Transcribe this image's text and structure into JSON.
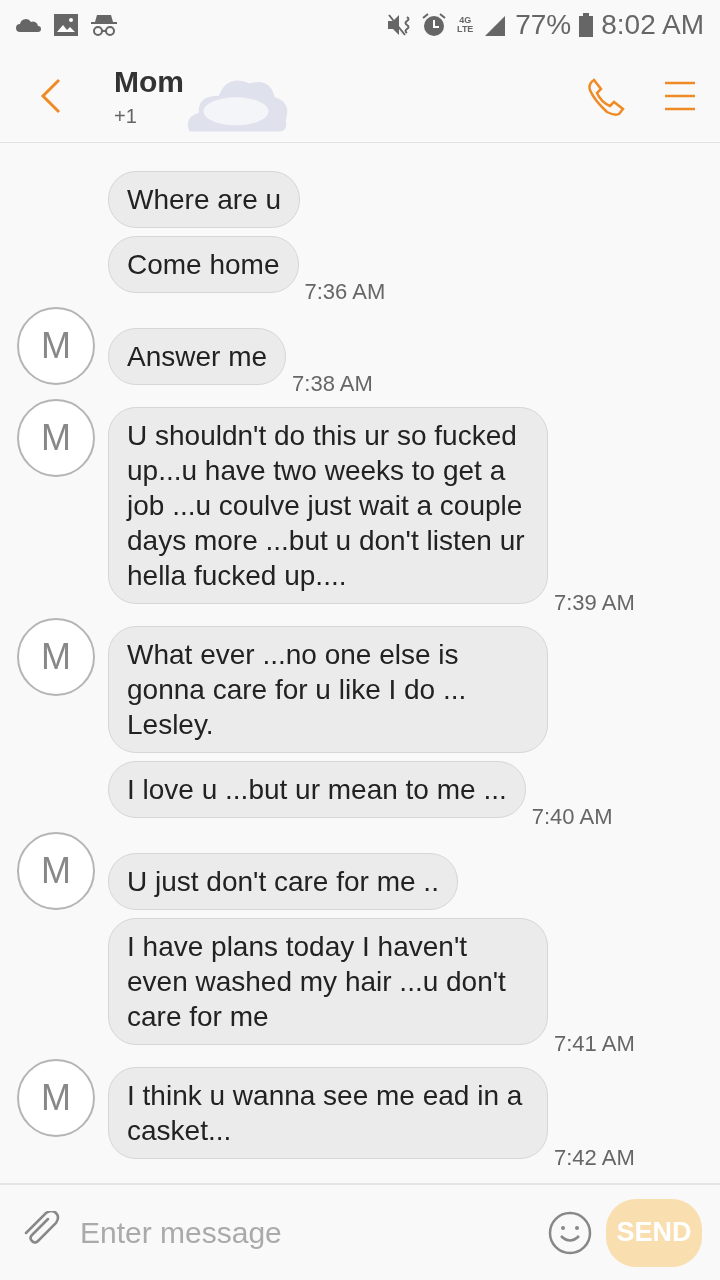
{
  "status_bar": {
    "battery": "77%",
    "time": "8:02 AM",
    "network": "4G LTE"
  },
  "header": {
    "name": "Mom",
    "number": "+1"
  },
  "messages": [
    {
      "text": "Where are u"
    },
    {
      "text": "Come home",
      "time": "7:36 AM"
    },
    {
      "avatar": "M",
      "text": "Answer me",
      "time": "7:38 AM"
    },
    {
      "avatar": "M",
      "text": "U shouldn't do this ur so fucked up...u have two weeks to get a job ...u coulve just wait a couple days more ...but u don't listen ur hella fucked up....",
      "time": "7:39 AM"
    },
    {
      "avatar": "M",
      "text": "What ever ...no one else is gonna care for u like I do ... Lesley."
    },
    {
      "text": "I love u ...but ur mean to me ...",
      "time": "7:40 AM"
    },
    {
      "avatar": "M",
      "text": "U just don't care for me .."
    },
    {
      "text": "I have plans today I haven't even washed my hair ...u don't care for me",
      "time": "7:41 AM"
    },
    {
      "avatar": "M",
      "text": "I think u wanna see me ead in a casket...",
      "time": "7:42 AM"
    }
  ],
  "composer": {
    "placeholder": "Enter message",
    "send": {
      "label": "SEND",
      "disabled": true
    }
  }
}
